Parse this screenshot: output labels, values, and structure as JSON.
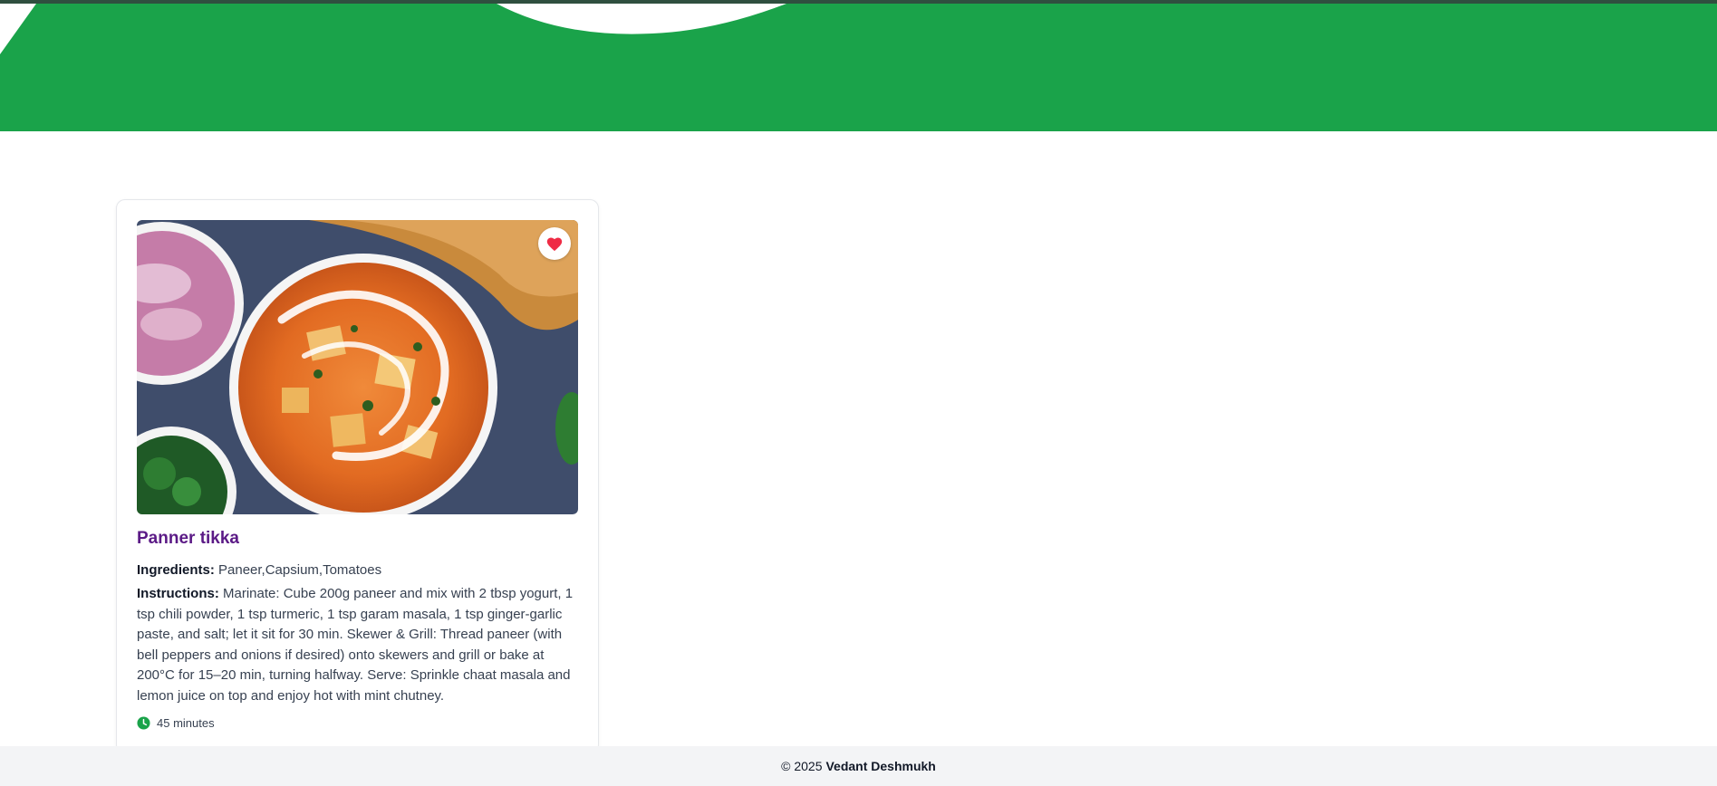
{
  "colors": {
    "brand_green": "#1aa34a",
    "title_purple": "#5b1a86",
    "heart_red": "#ef2b45",
    "footer_bg": "#f3f4f6"
  },
  "recipe": {
    "title": "Panner tikka",
    "ingredients_label": "Ingredients:",
    "ingredients": "Paneer,Capsium,Tomatoes",
    "instructions_label": "Instructions:",
    "instructions": "Marinate: Cube 200g paneer and mix with 2 tbsp yogurt, 1 tsp chili powder, 1 tsp turmeric, 1 tsp garam masala, 1 tsp ginger-garlic paste, and salt; let it sit for 30 min. Skewer & Grill: Thread paneer (with bell peppers and onions if desired) onto skewers and grill or bake at 200°C for 15–20 min, turning halfway. Serve: Sprinkle chaat masala and lemon juice on top and enjoy hot with mint chutney.",
    "time": "45 minutes",
    "favorite_icon": "heart-icon",
    "time_icon": "clock-icon"
  },
  "footer": {
    "copyright": "© 2025",
    "author": "Vedant Deshmukh"
  }
}
